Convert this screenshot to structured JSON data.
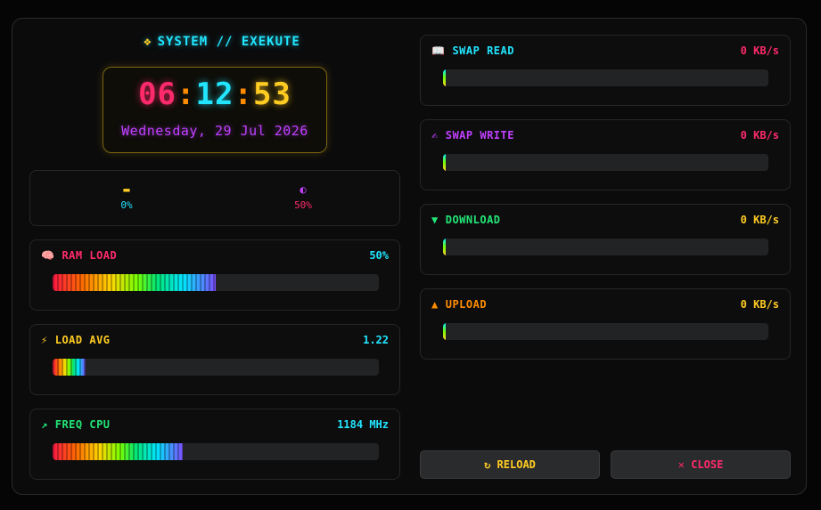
{
  "header": {
    "title": "SYSTEM // EXEKUTE",
    "title_icon": "diamond-icon"
  },
  "clock": {
    "hours": "06",
    "minutes": "12",
    "seconds": "53",
    "sep": ":",
    "date": "Wednesday, 29 Jul 2026"
  },
  "mini_stats": [
    {
      "icon": "small-dash-icon",
      "value": "0%",
      "color": "#22e6ff"
    },
    {
      "icon": "moon-icon",
      "value": "50%",
      "color": "#ff2a6a"
    }
  ],
  "left_meters": [
    {
      "label": "RAM LOAD",
      "icon": "brain-icon",
      "icon_glyph": "🧠",
      "value": "50%",
      "label_color": "#ff2a6a",
      "value_color": "#22e6ff",
      "fraction": 0.5
    },
    {
      "label": "LOAD AVG",
      "icon": "lightning-icon",
      "icon_glyph": "⚡",
      "value": "1.22",
      "label_color": "#ffcc22",
      "value_color": "#22e6ff",
      "fraction": 0.1
    },
    {
      "label": "FREQ CPU",
      "icon": "pulse-icon",
      "icon_glyph": "↗",
      "value": "1184 MHz",
      "label_color": "#22e676",
      "value_color": "#22e6ff",
      "fraction": 0.4
    }
  ],
  "right_meters": [
    {
      "label": "SWAP READ",
      "icon": "book-icon",
      "icon_glyph": "📖",
      "value": "0 KB/s",
      "label_color": "#22e6ff",
      "value_color": "#ff2a6a",
      "fraction": 0
    },
    {
      "label": "SWAP WRITE",
      "icon": "writing-hand-icon",
      "icon_glyph": "✍",
      "value": "0 KB/s",
      "label_color": "#c040ff",
      "value_color": "#ff2a6a",
      "fraction": 0
    },
    {
      "label": "DOWNLOAD",
      "icon": "down-triangle-icon",
      "icon_glyph": "▼",
      "value": "0 KB/s",
      "label_color": "#22e676",
      "value_color": "#ffcc22",
      "fraction": 0
    },
    {
      "label": "UPLOAD",
      "icon": "up-triangle-icon",
      "icon_glyph": "▲",
      "value": "0 KB/s",
      "label_color": "#ff8c00",
      "value_color": "#ffcc22",
      "fraction": 0
    }
  ],
  "buttons": {
    "reload": {
      "icon": "reload-icon",
      "glyph": "↻",
      "label": "RELOAD",
      "color": "#ffcc22"
    },
    "close": {
      "icon": "close-icon",
      "glyph": "✕",
      "label": "CLOSE",
      "color": "#ff2a6a"
    }
  }
}
